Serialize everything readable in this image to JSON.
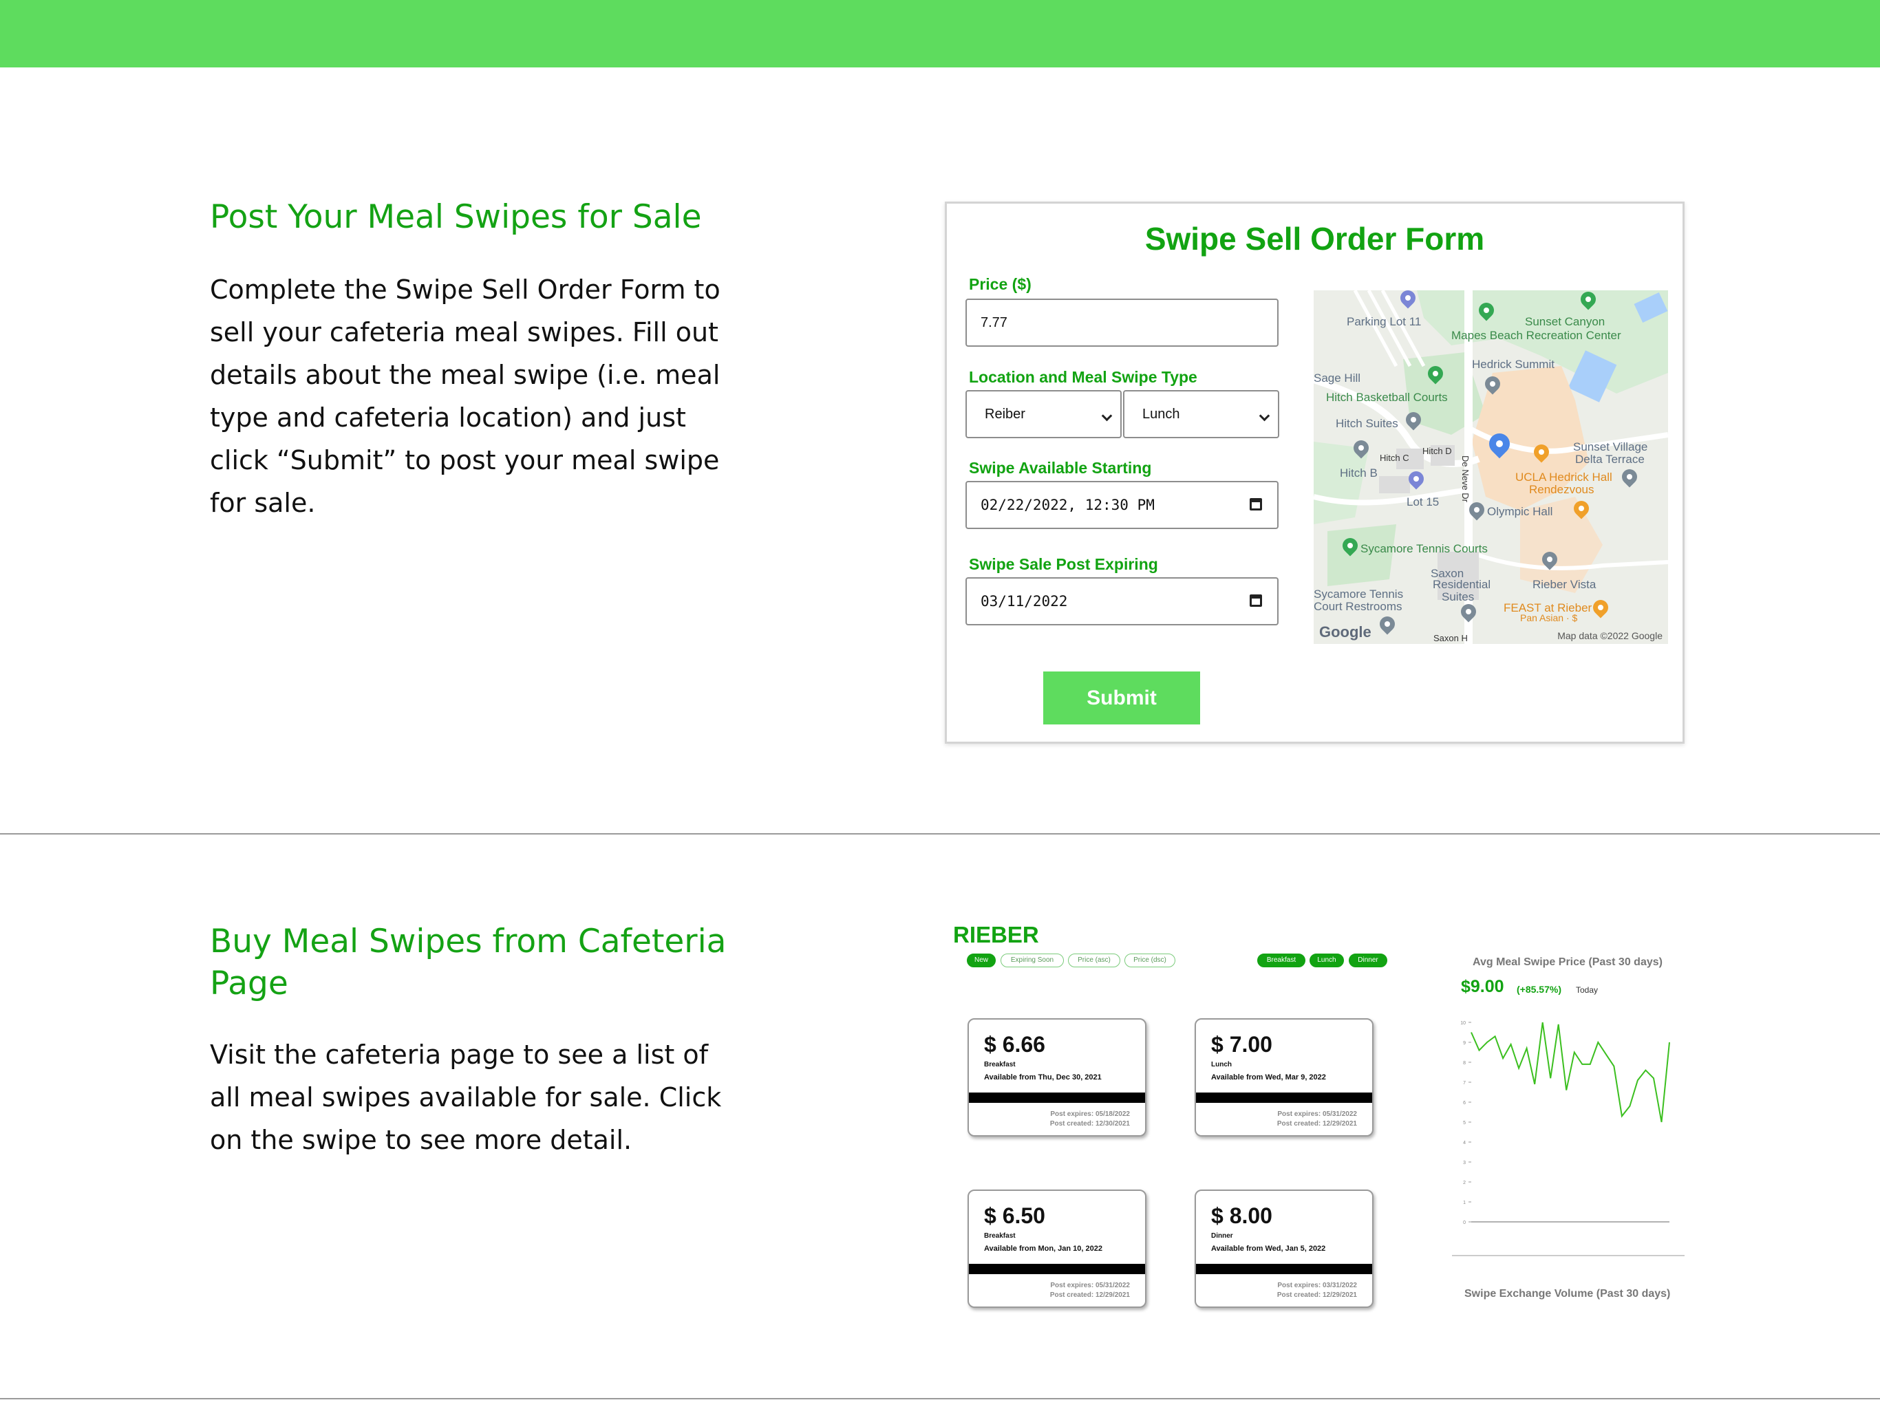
{
  "section1": {
    "title": "Post Your Meal Swipes for Sale",
    "description": "Complete the Swipe Sell Order Form to sell your cafeteria meal swipes. Fill out details about the meal swipe (i.e. meal type and cafeteria location) and just click “Submit” to post your meal swipe for sale."
  },
  "form": {
    "title": "Swipe Sell Order Form",
    "price_label": "Price ($)",
    "price_value": "7.77",
    "location_label": "Location and Meal Swipe Type",
    "location_value": "Reiber",
    "meal_type_value": "Lunch",
    "start_label": "Swipe Available Starting",
    "start_value": "02/22/2022, 12:30 PM",
    "expire_label": "Swipe Sale Post Expiring",
    "expire_value": "03/11/2022",
    "submit_label": "Submit"
  },
  "map": {
    "labels": {
      "parking11": "Parking Lot 11",
      "mapes": "Mapes Beach Recreation Center",
      "sunset_canyon": "Sunset Canyon",
      "hedrick_summit": "Hedrick Summit",
      "sage_hill": "Sage Hill",
      "hitch_courts": "Hitch Basketball Courts",
      "hitch_suites": "Hitch Suites",
      "hitch_c": "Hitch C",
      "hitch_d": "Hitch D",
      "hitch_b": "Hitch B",
      "de_neve": "De Neve Dr",
      "sunset_village": "Sunset Village",
      "delta_terrace": "Delta Terrace",
      "hedrick_hall": "UCLA Hedrick Hall",
      "rendezvous": "Rendezvous",
      "lot15": "Lot 15",
      "olympic": "Olympic Hall",
      "sycamore_courts": "Sycamore Tennis Courts",
      "saxon": "Saxon",
      "residential": "Residential",
      "suites": "Suites",
      "rieber_vista": "Rieber Vista",
      "sycamore_restrooms1": "Sycamore Tennis",
      "sycamore_restrooms2": "Court Restrooms",
      "feast": "FEAST at Rieber",
      "pan_asian": "Pan Asian · $",
      "saxon_h": "Saxon H",
      "google": "Google",
      "credit": "Map data ©2022 Google"
    }
  },
  "section2": {
    "title": "Buy Meal Swipes from Cafeteria Page",
    "description": "Visit the cafeteria page to see a list of all meal swipes available for sale. Click on the swipe to see more detail."
  },
  "cafeteria": {
    "name": "RIEBER",
    "sort_filters": [
      "New",
      "Expiring Soon",
      "Price (asc)",
      "Price (dsc)"
    ],
    "meal_filters": [
      "Breakfast",
      "Lunch",
      "Dinner"
    ],
    "cards": [
      {
        "price": "$ 6.66",
        "type": "Breakfast",
        "available": "Available from Thu, Dec 30, 2021",
        "expires": "Post expires: 05/18/2022",
        "created": "Post created: 12/30/2021"
      },
      {
        "price": "$ 7.00",
        "type": "Lunch",
        "available": "Available from Wed, Mar 9, 2022",
        "expires": "Post expires: 05/31/2022",
        "created": "Post created: 12/29/2021"
      },
      {
        "price": "$ 6.50",
        "type": "Breakfast",
        "available": "Available from Mon, Jan 10, 2022",
        "expires": "Post expires: 05/31/2022",
        "created": "Post created: 12/29/2021"
      },
      {
        "price": "$ 8.00",
        "type": "Dinner",
        "available": "Available from Wed, Jan 5, 2022",
        "expires": "Post expires: 03/31/2022",
        "created": "Post created: 12/29/2021"
      }
    ],
    "chart_title": "Avg Meal Swipe Price (Past 30 days)",
    "chart_price": "$9.00",
    "chart_change": "(+85.57%)",
    "chart_today": "Today",
    "volume_title": "Swipe Exchange Volume (Past 30 days)"
  },
  "chart_data": {
    "type": "line",
    "title": "Avg Meal Swipe Price (Past 30 days)",
    "yticks": [
      0,
      1,
      2,
      3,
      4,
      5,
      6,
      7,
      8,
      9,
      10
    ],
    "ylim": [
      0,
      10
    ],
    "series": [
      {
        "values": [
          9.5,
          8.6,
          9.0,
          9.3,
          8.2,
          8.9,
          7.7,
          8.7,
          6.9,
          10.0,
          7.2,
          9.9,
          6.6,
          8.5,
          7.9,
          7.9,
          9.0,
          8.4,
          7.8,
          5.3,
          5.8,
          7.1,
          7.6,
          7.2,
          5.0,
          9.0
        ],
        "color": "#3bbf1f"
      }
    ]
  }
}
